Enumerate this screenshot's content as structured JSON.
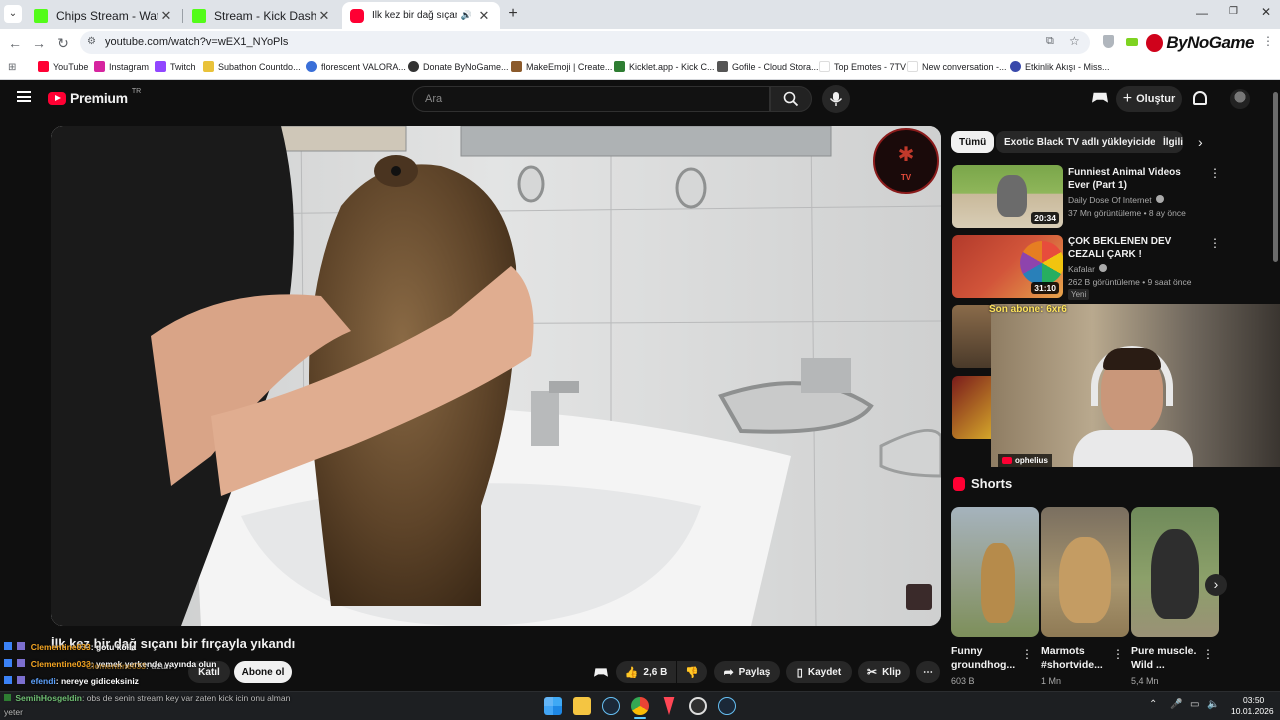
{
  "browser": {
    "tabs": [
      {
        "title": "Chips Stream - Watch Live on K",
        "active": false,
        "favicon_color": "#53fc18"
      },
      {
        "title": "Stream - Kick Dashboard",
        "active": false,
        "favicon_color": "#53fc18"
      },
      {
        "title": "İlk kez bir dağ sıçanı bir fırç",
        "active": true,
        "favicon_color": "#ff0033"
      }
    ],
    "new_tab": "+",
    "url": "youtube.com/watch?v=wEX1_NYoPls",
    "bookmarks": [
      {
        "label": "YouTube",
        "color": "#ff0033"
      },
      {
        "label": "Instagram",
        "color": "#d6249f"
      },
      {
        "label": "Twitch",
        "color": "#9146ff"
      },
      {
        "label": "Subathon Countdo...",
        "color": "#e9c23a"
      },
      {
        "label": "florescent VALORA...",
        "color": "#3a6fd8"
      },
      {
        "label": "Donate ByNoGame...",
        "color": "#333333"
      },
      {
        "label": "MakeEmoji | Create...",
        "color": "#8b5a2b"
      },
      {
        "label": "Kicklet.app - Kick C...",
        "color": "#2e7d32"
      },
      {
        "label": "Gofile - Cloud Stora...",
        "color": "#555555"
      },
      {
        "label": "Top Emotes - 7TV",
        "color": "#ffffff"
      },
      {
        "label": "New conversation -...",
        "color": "#ffffff"
      },
      {
        "label": "Etkinlik Akışı - Miss...",
        "color": "#3949ab"
      }
    ],
    "brand_overlay": "ByNoGame"
  },
  "youtube": {
    "logo": "Premium",
    "logo_superscript": "TR",
    "search_placeholder": "Ara",
    "create_label": "Oluştur",
    "chips": [
      "Tümü",
      "Exotic Black TV adlı yükleyiciden",
      "İlgili"
    ],
    "video": {
      "title": "İlk kez bir dağ sıçanı bir fırçayla yıkandı",
      "channel_watermark": "TV"
    },
    "actions": {
      "join": "Katıl",
      "subscribe": "Abone ol",
      "likes": "2,6 B",
      "share": "Paylaş",
      "save": "Kaydet",
      "clip": "Klip"
    },
    "recommended": [
      {
        "title": "Funniest Animal Videos Ever (Part 1)",
        "channel": "Daily Dose Of Internet",
        "meta": "37 Mn görüntüleme • 8 ay önce",
        "duration": "20:34",
        "badge": ""
      },
      {
        "title": "ÇOK BEKLENEN DEV CEZALI ÇARK !",
        "channel": "Kafalar",
        "meta": "262 B görüntüleme • 9 saat önce",
        "duration": "31:10",
        "badge": "Yeni"
      }
    ],
    "shorts_heading": "Shorts",
    "shorts": [
      {
        "title": "Funny groundhog...",
        "views": "603 B"
      },
      {
        "title": "Marmots #shortvide...",
        "views": "1 Mn"
      },
      {
        "title": "Pure muscle. Wild ...",
        "views": "5,4 Mn"
      }
    ]
  },
  "stream_overlay": {
    "last_subscriber": "Son abone: 6xr6",
    "streamer_handle": "ophelius",
    "chat": [
      {
        "user": "Clementine033",
        "message": ": gotu kolla"
      },
      {
        "user": "Clementine033",
        "message": ": uzun"
      },
      {
        "user": "Clementine033",
        "message": ": yemek yerkende yayında olun"
      },
      {
        "user": "efendi",
        "message": ": nereye gidiceksiniz"
      },
      {
        "user": "SemihHosgeldin",
        "message": ": obs de senin stream key var zaten kick icin onu alman"
      },
      {
        "user": "",
        "message": "yeter"
      }
    ]
  },
  "taskbar": {
    "time": "03:50",
    "date": "10.01.2026"
  }
}
